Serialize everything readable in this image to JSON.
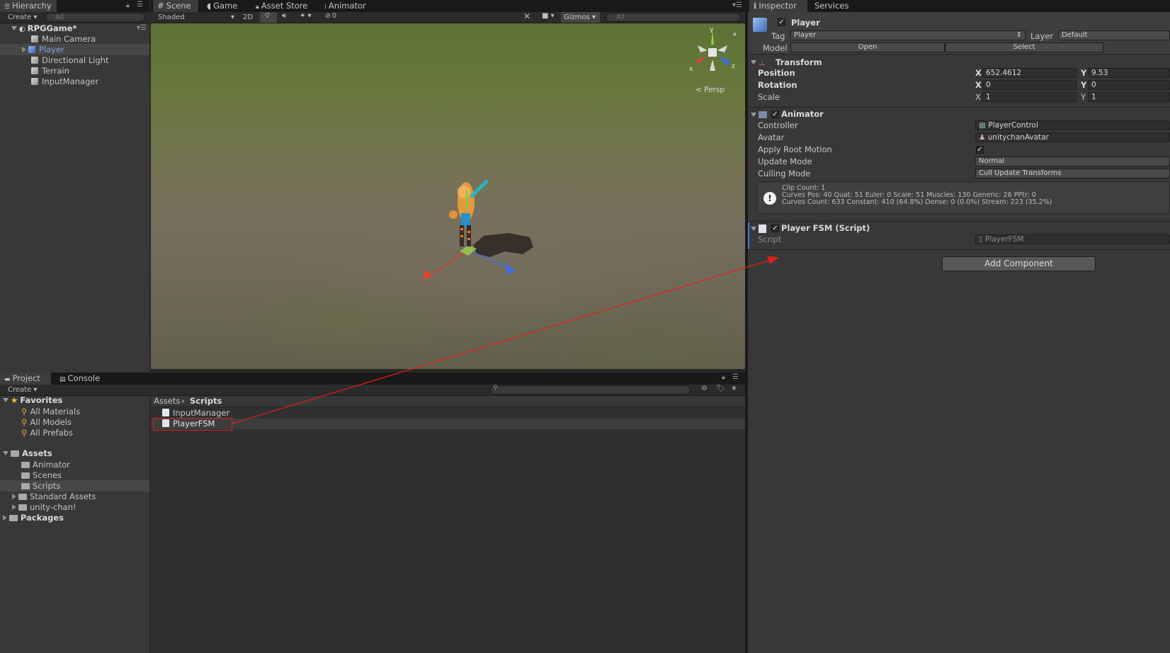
{
  "hierarchy": {
    "tab": "Hierarchy",
    "create": "Create",
    "search_placeholder": "All",
    "scene": "RPGGame*",
    "items": [
      "Main Camera",
      "Player",
      "Directional Light",
      "Terrain",
      "InputManager"
    ]
  },
  "scene_tabs": [
    "Scene",
    "Game",
    "Asset Store",
    "Animator"
  ],
  "scene_toolbar": {
    "shading": "Shaded",
    "mode_2d": "2D",
    "hidden_count": "0",
    "gizmos": "Gizmos",
    "search_placeholder": "All"
  },
  "scene_view": {
    "persp": "< Persp",
    "axis_x": "x",
    "axis_y": "y",
    "axis_z": "z"
  },
  "project": {
    "tabs": [
      "Project",
      "Console"
    ],
    "create": "Create",
    "favorites_label": "Favorites",
    "favorites": [
      "All Materials",
      "All Models",
      "All Prefabs"
    ],
    "assets_label": "Assets",
    "folders": [
      "Animator",
      "Scenes",
      "Scripts",
      "Standard Assets",
      "unity-chan!"
    ],
    "packages_label": "Packages",
    "breadcrumb": [
      "Assets",
      "Scripts"
    ],
    "files": [
      "InputManager",
      "PlayerFSM"
    ]
  },
  "inspector": {
    "tabs": [
      "Inspector",
      "Services"
    ],
    "object_name": "Player",
    "tag_label": "Tag",
    "tag_value": "Player",
    "layer_label": "Layer",
    "layer_value": "Default",
    "model_label": "Model",
    "open": "Open",
    "select": "Select",
    "transform": {
      "title": "Transform",
      "position_label": "Position",
      "rotation_label": "Rotation",
      "scale_label": "Scale",
      "x_label": "X",
      "y_label": "Y",
      "position_x": "652.4612",
      "position_y": "9.53",
      "rotation_x": "0",
      "rotation_y": "0",
      "scale_x": "1",
      "scale_y": "1"
    },
    "animator": {
      "title": "Animator",
      "controller_label": "Controller",
      "controller_value": "PlayerControl",
      "avatar_label": "Avatar",
      "avatar_value": "unitychanAvatar",
      "root_motion_label": "Apply Root Motion",
      "update_label": "Update Mode",
      "update_value": "Normal",
      "culling_label": "Culling Mode",
      "culling_value": "Cull Update Transforms",
      "info_line1": "Clip Count: 1",
      "info_line2": "Curves Pos: 40 Quat: 51 Euler: 0 Scale: 51 Muscles: 130 Generic: 26 PPtr: 0",
      "info_line3": "Curves Count: 633 Constant: 410 (64.8%) Dense: 0 (0.0%) Stream: 223 (35.2%)"
    },
    "script_component": {
      "title": "Player FSM (Script)",
      "script_label": "Script",
      "script_value": "PlayerFSM"
    },
    "add_component": "Add Component"
  },
  "colors": {
    "annotation": "#e0201c",
    "selection": "#3e5f96"
  }
}
